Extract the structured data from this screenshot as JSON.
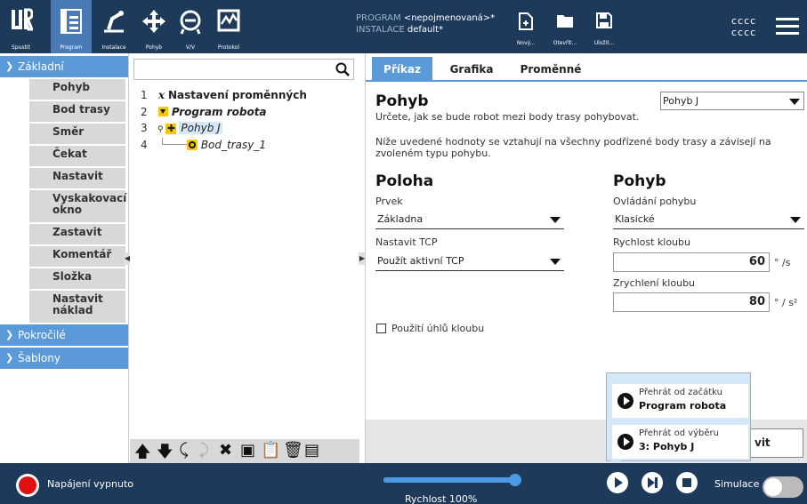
{
  "header": {
    "nav": [
      {
        "label": "Spustit",
        "icon": "ur-logo-icon"
      },
      {
        "label": "Program",
        "icon": "program-icon"
      },
      {
        "label": "Instalace",
        "icon": "installation-icon"
      },
      {
        "label": "Pohyb",
        "icon": "move-icon"
      },
      {
        "label": "V/V",
        "icon": "io-icon"
      },
      {
        "label": "Protokol",
        "icon": "log-icon"
      }
    ],
    "program_label": "PROGRAM",
    "program_name": "<nepojmenovaná>*",
    "installation_label": "INSTALACE",
    "installation_name": "default*",
    "file_buttons": [
      "Nový...",
      "Otevřít...",
      "Uložit..."
    ],
    "user_line1": "cccc",
    "user_line2": "cccc"
  },
  "leftnav": {
    "basic_header": "Základní",
    "items": [
      "Pohyb",
      "Bod trasy",
      "Směr",
      "Čekat",
      "Nastavit",
      "Vyskakovací okno",
      "Zastavit",
      "Komentář",
      "Složka",
      "Nastavit náklad"
    ],
    "advanced_header": "Pokročilé",
    "templates_header": "Šablony"
  },
  "tree": {
    "search_value": "",
    "lines": [
      {
        "num": "1",
        "text": "Nastavení proměnných"
      },
      {
        "num": "2",
        "text": "Program robota"
      },
      {
        "num": "3",
        "text": "Pohyb J"
      },
      {
        "num": "4",
        "text": "Bod_trasy_1"
      }
    ]
  },
  "tabs": [
    "Příkaz",
    "Grafika",
    "Proměnné"
  ],
  "command": {
    "title": "Pohyb",
    "type_select": "Pohyb J",
    "desc1": "Určete, jak se bude robot mezi body trasy pohybovat.",
    "desc2": "Níže uvedené hodnoty se vztahují na všechny podřízené body trasy a závisejí na",
    "desc3": "zvoleném typu pohybu.",
    "position_title": "Poloha",
    "feature_label": "Prvek",
    "feature_value": "Základna",
    "tcp_label": "Nastavit TCP",
    "tcp_value": "Použít aktivní TCP",
    "joint_angles_label": "Použití úhlů kloubu",
    "motion_title": "Pohyb",
    "control_label": "Ovládání pohybu",
    "control_value": "Klasické",
    "speed_label": "Rychlost kloubu",
    "speed_value": "60",
    "speed_unit": "° /s",
    "accel_label": "Zrychlení kloubu",
    "accel_value": "80",
    "accel_unit": "° / s²",
    "proceed_label": "vit"
  },
  "popup": {
    "item1_l1": "Přehrát od začátku",
    "item1_l2": "Program robota",
    "item2_l1": "Přehrát od výběru",
    "item2_l2": "3: Pohyb J"
  },
  "footer": {
    "power_label": "Napájení vypnuto",
    "speed_label": "Rychlost 100%",
    "speed_fraction": 1.0,
    "simulation_label": "Simulace",
    "simulation_on": false
  },
  "colors": {
    "header_bg": "#1e3a5a",
    "accent": "#5a9ad8",
    "power_red": "#e01010"
  }
}
